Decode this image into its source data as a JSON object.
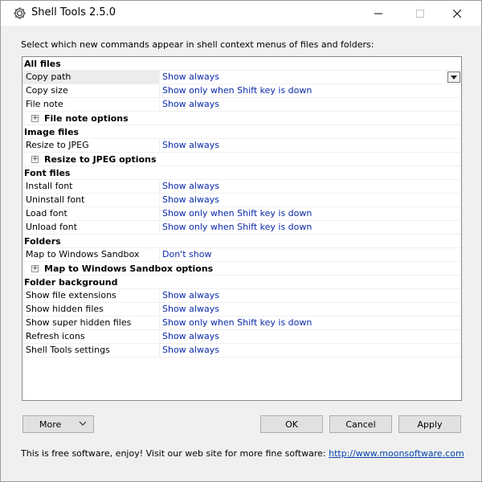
{
  "window": {
    "title": "Shell Tools 2.5.0",
    "icon": "gear-icon",
    "controls": [
      "minimize",
      "maximize",
      "close"
    ]
  },
  "instructions": "Select which new commands appear in shell context menus of files and folders:",
  "categories": [
    {
      "label": "All files",
      "items": [
        {
          "name": "Copy path",
          "value": "Show always",
          "selected": true
        },
        {
          "name": "Copy size",
          "value": "Show only when Shift key is down"
        },
        {
          "name": "File note",
          "value": "Show always"
        }
      ],
      "sub": "File note options"
    },
    {
      "label": "Image files",
      "items": [
        {
          "name": "Resize to JPEG",
          "value": "Show always"
        }
      ],
      "sub": "Resize to JPEG options"
    },
    {
      "label": "Font files",
      "items": [
        {
          "name": "Install font",
          "value": "Show always"
        },
        {
          "name": "Uninstall font",
          "value": "Show always"
        },
        {
          "name": "Load font",
          "value": "Show only when Shift key is down"
        },
        {
          "name": "Unload font",
          "value": "Show only when Shift key is down"
        }
      ]
    },
    {
      "label": "Folders",
      "items": [
        {
          "name": "Map to Windows Sandbox",
          "value": "Don't show"
        }
      ],
      "sub": "Map to Windows Sandbox options"
    },
    {
      "label": "Folder background",
      "items": [
        {
          "name": "Show file extensions",
          "value": "Show always"
        },
        {
          "name": "Show hidden files",
          "value": "Show always"
        },
        {
          "name": "Show super hidden files",
          "value": "Show only when Shift key is down"
        },
        {
          "name": "Refresh icons",
          "value": "Show always"
        },
        {
          "name": "Shell Tools settings",
          "value": "Show always"
        }
      ]
    }
  ],
  "buttons": {
    "more": "More",
    "ok": "OK",
    "cancel": "Cancel",
    "apply": "Apply"
  },
  "footer": {
    "text": "This is free software, enjoy! Visit our web site for more fine software: ",
    "link": "http://www.moonsoftware.com"
  },
  "colors": {
    "value_text": "#0a2aa8",
    "link": "#0645ad"
  }
}
